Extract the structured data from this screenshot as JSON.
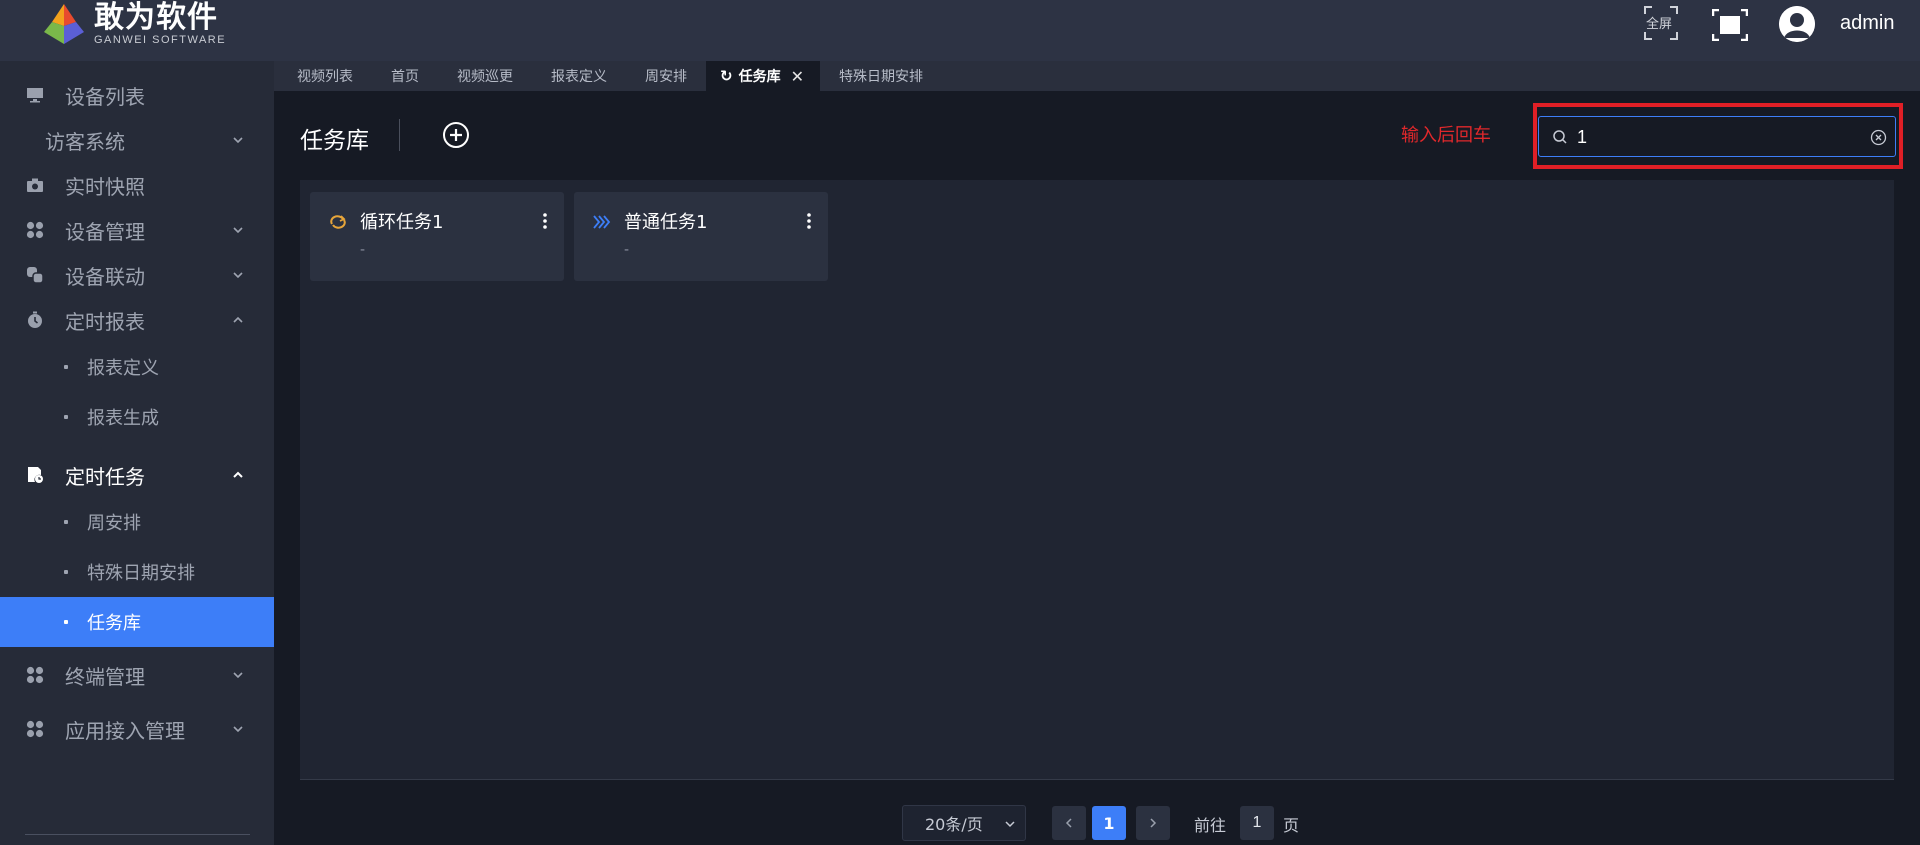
{
  "header": {
    "logo_cn": "敢为软件",
    "logo_en": "GANWEI SOFTWARE",
    "fullscreen_label": "全屏",
    "username": "admin"
  },
  "tabs": [
    {
      "label": "视频列表",
      "active": false
    },
    {
      "label": "首页",
      "active": false
    },
    {
      "label": "视频巡更",
      "active": false
    },
    {
      "label": "报表定义",
      "active": false
    },
    {
      "label": "周安排",
      "active": false
    },
    {
      "label": "任务库",
      "active": true
    },
    {
      "label": "特殊日期安排",
      "active": false
    }
  ],
  "sidebar": {
    "items": [
      {
        "label": "设备列表",
        "icon": "monitor-icon"
      },
      {
        "label": "访客系统",
        "icon": "none"
      },
      {
        "label": "实时快照",
        "icon": "camera-icon"
      },
      {
        "label": "设备管理",
        "icon": "grid-icon"
      },
      {
        "label": "设备联动",
        "icon": "link-icon"
      },
      {
        "label": "定时报表",
        "icon": "timer-icon"
      },
      {
        "label": "定时任务",
        "icon": "task-icon"
      },
      {
        "label": "终端管理",
        "icon": "grid-icon"
      },
      {
        "label": "应用接入管理",
        "icon": "grid-icon"
      }
    ],
    "sub_report": [
      "报表定义",
      "报表生成"
    ],
    "sub_task": [
      "周安排",
      "特殊日期安排",
      "任务库"
    ],
    "active_color": "#3d7ef8"
  },
  "main": {
    "title": "任务库",
    "hint": "输入后回车",
    "search_value": "1",
    "cards": [
      {
        "name": "循环任务1",
        "desc": "-",
        "icon": "loop-icon"
      },
      {
        "name": "普通任务1",
        "desc": "-",
        "icon": "chevrons-right-icon"
      }
    ]
  },
  "pagination": {
    "page_size": "20条/页",
    "current_page": "1",
    "goto_label": "前往",
    "goto_value": "1",
    "page_unit": "页"
  }
}
